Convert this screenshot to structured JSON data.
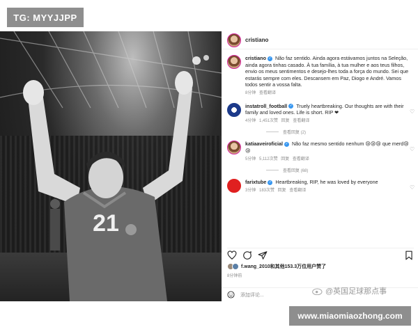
{
  "watermark": {
    "tg": "TG: MYYJJPP",
    "site": "www.miaomiaozhong.com",
    "weibo": "@英国足球那点事"
  },
  "photo": {
    "jersey_number": "21"
  },
  "post": {
    "username": "cristiano",
    "caption": {
      "user": "cristiano",
      "text": "Não faz sentido. Ainda agora estávamos juntos na Seleção, ainda agora tinhas casado. À tua família, à tua mulher e aos teus filhos, envio os meus sentimentos e desejo-lhes toda a força do mundo. Sei que estarás sempre com eles. Descansem em Paz, Diogo e André. Vamos todos sentir a vossa falta.",
      "meta": "8分钟 查看翻译"
    },
    "comments": [
      {
        "user": "instatroll_football",
        "text": "Truely heartbreaking. Our thoughts are with their family and loved ones. Life is short. RIP ❤",
        "meta": "4分钟 1,451次赞 回复 查看翻译",
        "replies": "查看回复 (2)"
      },
      {
        "user": "katiaaveiroficial",
        "text": "Não faz mesmo sentido nenhum 😢😢😢 que merd😢😢",
        "meta": "5分钟 5,112次赞 回复 查看翻译",
        "replies": "查看回复 (68)"
      },
      {
        "user": "farixtube",
        "text": "Heartbreaking, RIP, he was loved by everyone",
        "meta": "3分钟 183次赞 回复 查看翻译"
      }
    ],
    "likes": "f.wang_2010和其他153.3万位用户赞了",
    "time": "8分钟前",
    "add_comment_placeholder": "添加评论..."
  },
  "colors": {
    "verified": "#3897f0",
    "heart": "#ed4956",
    "muted": "#8e8e8e"
  }
}
